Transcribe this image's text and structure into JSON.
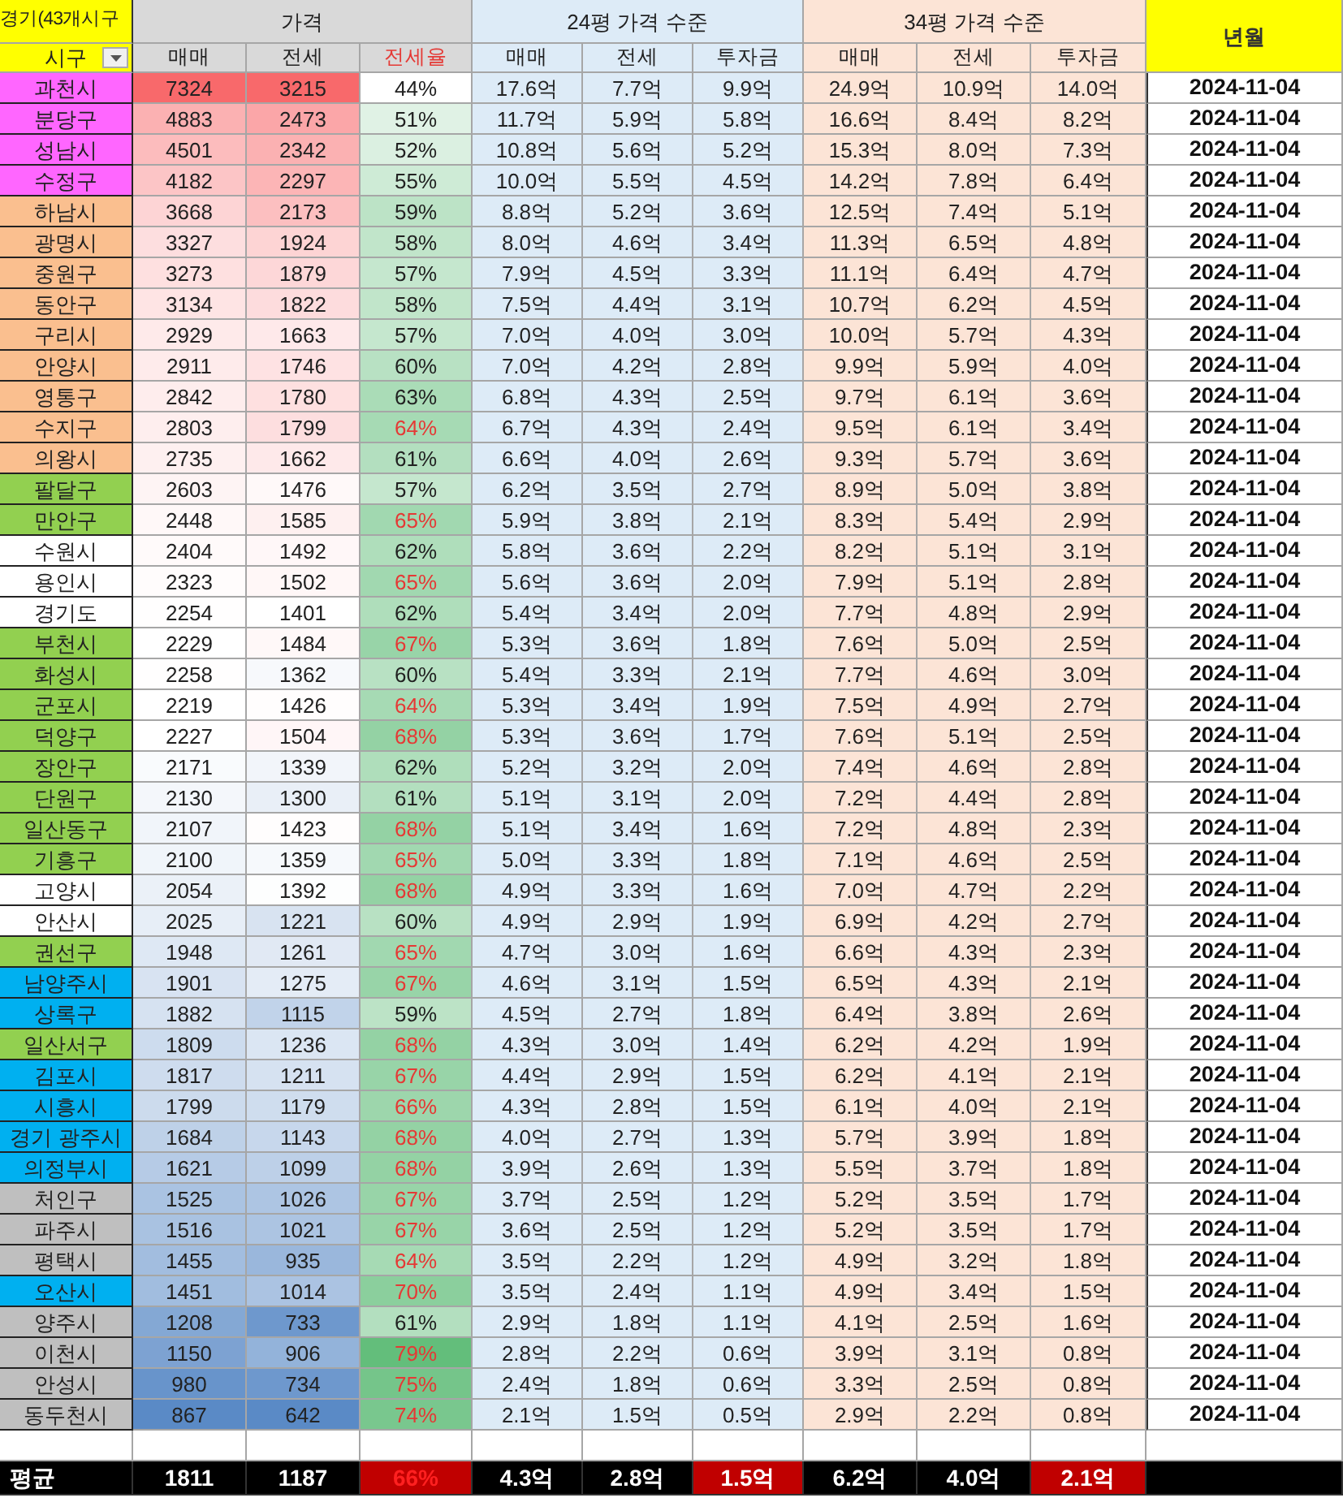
{
  "title_cell": "경기(43개시구",
  "region_header": "시구",
  "price_group": "가격",
  "group24": "24평 가격 수준",
  "group34": "34평 가격 수준",
  "date_header": "년월",
  "price_columns": [
    {
      "label": "매매",
      "highlight": false
    },
    {
      "label": "전세",
      "highlight": false
    },
    {
      "label": "전세율",
      "highlight": true
    }
  ],
  "columns24": [
    "매매",
    "전세",
    "투자금"
  ],
  "columns34": [
    "매매",
    "전세",
    "투자금"
  ],
  "rows": [
    {
      "name": "과천시",
      "color": "#ff66ff",
      "sale": "7324",
      "jeonse": "3215",
      "ratio": "44%",
      "flagged": false,
      "p24": [
        "17.6억",
        "7.7억",
        "9.9억"
      ],
      "p34": [
        "24.9억",
        "10.9억",
        "14.0억"
      ],
      "date": "2024-11-04"
    },
    {
      "name": "분당구",
      "color": "#ff66ff",
      "sale": "4883",
      "jeonse": "2473",
      "ratio": "51%",
      "flagged": false,
      "p24": [
        "11.7억",
        "5.9억",
        "5.8억"
      ],
      "p34": [
        "16.6억",
        "8.4억",
        "8.2억"
      ],
      "date": "2024-11-04"
    },
    {
      "name": "성남시",
      "color": "#ff66ff",
      "sale": "4501",
      "jeonse": "2342",
      "ratio": "52%",
      "flagged": false,
      "p24": [
        "10.8억",
        "5.6억",
        "5.2억"
      ],
      "p34": [
        "15.3억",
        "8.0억",
        "7.3억"
      ],
      "date": "2024-11-04"
    },
    {
      "name": "수정구",
      "color": "#ff66ff",
      "sale": "4182",
      "jeonse": "2297",
      "ratio": "55%",
      "flagged": false,
      "p24": [
        "10.0억",
        "5.5억",
        "4.5억"
      ],
      "p34": [
        "14.2억",
        "7.8억",
        "6.4억"
      ],
      "date": "2024-11-04"
    },
    {
      "name": "하남시",
      "color": "#fabf8f",
      "sale": "3668",
      "jeonse": "2173",
      "ratio": "59%",
      "flagged": false,
      "p24": [
        "8.8억",
        "5.2억",
        "3.6억"
      ],
      "p34": [
        "12.5억",
        "7.4억",
        "5.1억"
      ],
      "date": "2024-11-04"
    },
    {
      "name": "광명시",
      "color": "#fabf8f",
      "sale": "3327",
      "jeonse": "1924",
      "ratio": "58%",
      "flagged": false,
      "p24": [
        "8.0억",
        "4.6억",
        "3.4억"
      ],
      "p34": [
        "11.3억",
        "6.5억",
        "4.8억"
      ],
      "date": "2024-11-04"
    },
    {
      "name": "중원구",
      "color": "#fabf8f",
      "sale": "3273",
      "jeonse": "1879",
      "ratio": "57%",
      "flagged": false,
      "p24": [
        "7.9억",
        "4.5억",
        "3.3억"
      ],
      "p34": [
        "11.1억",
        "6.4억",
        "4.7억"
      ],
      "date": "2024-11-04"
    },
    {
      "name": "동안구",
      "color": "#fabf8f",
      "sale": "3134",
      "jeonse": "1822",
      "ratio": "58%",
      "flagged": false,
      "p24": [
        "7.5억",
        "4.4억",
        "3.1억"
      ],
      "p34": [
        "10.7억",
        "6.2억",
        "4.5억"
      ],
      "date": "2024-11-04"
    },
    {
      "name": "구리시",
      "color": "#fabf8f",
      "sale": "2929",
      "jeonse": "1663",
      "ratio": "57%",
      "flagged": false,
      "p24": [
        "7.0억",
        "4.0억",
        "3.0억"
      ],
      "p34": [
        "10.0억",
        "5.7억",
        "4.3억"
      ],
      "date": "2024-11-04"
    },
    {
      "name": "안양시",
      "color": "#fabf8f",
      "sale": "2911",
      "jeonse": "1746",
      "ratio": "60%",
      "flagged": false,
      "p24": [
        "7.0억",
        "4.2억",
        "2.8억"
      ],
      "p34": [
        "9.9억",
        "5.9억",
        "4.0억"
      ],
      "date": "2024-11-04"
    },
    {
      "name": "영통구",
      "color": "#fabf8f",
      "sale": "2842",
      "jeonse": "1780",
      "ratio": "63%",
      "flagged": false,
      "p24": [
        "6.8억",
        "4.3억",
        "2.5억"
      ],
      "p34": [
        "9.7억",
        "6.1억",
        "3.6억"
      ],
      "date": "2024-11-04"
    },
    {
      "name": "수지구",
      "color": "#fabf8f",
      "sale": "2803",
      "jeonse": "1799",
      "ratio": "64%",
      "flagged": true,
      "p24": [
        "6.7억",
        "4.3억",
        "2.4억"
      ],
      "p34": [
        "9.5억",
        "6.1억",
        "3.4억"
      ],
      "date": "2024-11-04"
    },
    {
      "name": "의왕시",
      "color": "#fabf8f",
      "sale": "2735",
      "jeonse": "1662",
      "ratio": "61%",
      "flagged": false,
      "p24": [
        "6.6억",
        "4.0억",
        "2.6억"
      ],
      "p34": [
        "9.3억",
        "5.7억",
        "3.6억"
      ],
      "date": "2024-11-04"
    },
    {
      "name": "팔달구",
      "color": "#92d050",
      "sale": "2603",
      "jeonse": "1476",
      "ratio": "57%",
      "flagged": false,
      "p24": [
        "6.2억",
        "3.5억",
        "2.7억"
      ],
      "p34": [
        "8.9억",
        "5.0억",
        "3.8억"
      ],
      "date": "2024-11-04"
    },
    {
      "name": "만안구",
      "color": "#92d050",
      "sale": "2448",
      "jeonse": "1585",
      "ratio": "65%",
      "flagged": true,
      "p24": [
        "5.9억",
        "3.8억",
        "2.1억"
      ],
      "p34": [
        "8.3억",
        "5.4억",
        "2.9억"
      ],
      "date": "2024-11-04"
    },
    {
      "name": "수원시",
      "color": "#ffffff",
      "sale": "2404",
      "jeonse": "1492",
      "ratio": "62%",
      "flagged": false,
      "p24": [
        "5.8억",
        "3.6억",
        "2.2억"
      ],
      "p34": [
        "8.2억",
        "5.1억",
        "3.1억"
      ],
      "date": "2024-11-04"
    },
    {
      "name": "용인시",
      "color": "#ffffff",
      "sale": "2323",
      "jeonse": "1502",
      "ratio": "65%",
      "flagged": true,
      "p24": [
        "5.6억",
        "3.6억",
        "2.0억"
      ],
      "p34": [
        "7.9억",
        "5.1억",
        "2.8억"
      ],
      "date": "2024-11-04"
    },
    {
      "name": "경기도",
      "color": "#ffffff",
      "sale": "2254",
      "jeonse": "1401",
      "ratio": "62%",
      "flagged": false,
      "p24": [
        "5.4억",
        "3.4억",
        "2.0억"
      ],
      "p34": [
        "7.7억",
        "4.8억",
        "2.9억"
      ],
      "date": "2024-11-04"
    },
    {
      "name": "부천시",
      "color": "#92d050",
      "sale": "2229",
      "jeonse": "1484",
      "ratio": "67%",
      "flagged": true,
      "p24": [
        "5.3억",
        "3.6억",
        "1.8억"
      ],
      "p34": [
        "7.6억",
        "5.0억",
        "2.5억"
      ],
      "date": "2024-11-04"
    },
    {
      "name": "화성시",
      "color": "#92d050",
      "sale": "2258",
      "jeonse": "1362",
      "ratio": "60%",
      "flagged": false,
      "p24": [
        "5.4억",
        "3.3억",
        "2.1억"
      ],
      "p34": [
        "7.7억",
        "4.6억",
        "3.0억"
      ],
      "date": "2024-11-04"
    },
    {
      "name": "군포시",
      "color": "#92d050",
      "sale": "2219",
      "jeonse": "1426",
      "ratio": "64%",
      "flagged": true,
      "p24": [
        "5.3억",
        "3.4억",
        "1.9억"
      ],
      "p34": [
        "7.5억",
        "4.9억",
        "2.7억"
      ],
      "date": "2024-11-04"
    },
    {
      "name": "덕양구",
      "color": "#92d050",
      "sale": "2227",
      "jeonse": "1504",
      "ratio": "68%",
      "flagged": true,
      "p24": [
        "5.3억",
        "3.6억",
        "1.7억"
      ],
      "p34": [
        "7.6억",
        "5.1억",
        "2.5억"
      ],
      "date": "2024-11-04"
    },
    {
      "name": "장안구",
      "color": "#92d050",
      "sale": "2171",
      "jeonse": "1339",
      "ratio": "62%",
      "flagged": false,
      "p24": [
        "5.2억",
        "3.2억",
        "2.0억"
      ],
      "p34": [
        "7.4억",
        "4.6억",
        "2.8억"
      ],
      "date": "2024-11-04"
    },
    {
      "name": "단원구",
      "color": "#92d050",
      "sale": "2130",
      "jeonse": "1300",
      "ratio": "61%",
      "flagged": false,
      "p24": [
        "5.1억",
        "3.1억",
        "2.0억"
      ],
      "p34": [
        "7.2억",
        "4.4억",
        "2.8억"
      ],
      "date": "2024-11-04"
    },
    {
      "name": "일산동구",
      "color": "#92d050",
      "sale": "2107",
      "jeonse": "1423",
      "ratio": "68%",
      "flagged": true,
      "p24": [
        "5.1억",
        "3.4억",
        "1.6억"
      ],
      "p34": [
        "7.2억",
        "4.8억",
        "2.3억"
      ],
      "date": "2024-11-04"
    },
    {
      "name": "기흥구",
      "color": "#92d050",
      "sale": "2100",
      "jeonse": "1359",
      "ratio": "65%",
      "flagged": true,
      "p24": [
        "5.0억",
        "3.3억",
        "1.8억"
      ],
      "p34": [
        "7.1억",
        "4.6억",
        "2.5억"
      ],
      "date": "2024-11-04"
    },
    {
      "name": "고양시",
      "color": "#ffffff",
      "sale": "2054",
      "jeonse": "1392",
      "ratio": "68%",
      "flagged": true,
      "p24": [
        "4.9억",
        "3.3억",
        "1.6억"
      ],
      "p34": [
        "7.0억",
        "4.7억",
        "2.2억"
      ],
      "date": "2024-11-04"
    },
    {
      "name": "안산시",
      "color": "#ffffff",
      "sale": "2025",
      "jeonse": "1221",
      "ratio": "60%",
      "flagged": false,
      "p24": [
        "4.9억",
        "2.9억",
        "1.9억"
      ],
      "p34": [
        "6.9억",
        "4.2억",
        "2.7억"
      ],
      "date": "2024-11-04"
    },
    {
      "name": "권선구",
      "color": "#92d050",
      "sale": "1948",
      "jeonse": "1261",
      "ratio": "65%",
      "flagged": true,
      "p24": [
        "4.7억",
        "3.0억",
        "1.6억"
      ],
      "p34": [
        "6.6억",
        "4.3억",
        "2.3억"
      ],
      "date": "2024-11-04"
    },
    {
      "name": "남양주시",
      "color": "#00b0f0",
      "sale": "1901",
      "jeonse": "1275",
      "ratio": "67%",
      "flagged": true,
      "p24": [
        "4.6억",
        "3.1억",
        "1.5억"
      ],
      "p34": [
        "6.5억",
        "4.3억",
        "2.1억"
      ],
      "date": "2024-11-04"
    },
    {
      "name": "상록구",
      "color": "#00b0f0",
      "sale": "1882",
      "jeonse": "1115",
      "ratio": "59%",
      "flagged": false,
      "p24": [
        "4.5억",
        "2.7억",
        "1.8억"
      ],
      "p34": [
        "6.4억",
        "3.8억",
        "2.6억"
      ],
      "date": "2024-11-04"
    },
    {
      "name": "일산서구",
      "color": "#92d050",
      "sale": "1809",
      "jeonse": "1236",
      "ratio": "68%",
      "flagged": true,
      "p24": [
        "4.3억",
        "3.0억",
        "1.4억"
      ],
      "p34": [
        "6.2억",
        "4.2억",
        "1.9억"
      ],
      "date": "2024-11-04"
    },
    {
      "name": "김포시",
      "color": "#00b0f0",
      "sale": "1817",
      "jeonse": "1211",
      "ratio": "67%",
      "flagged": true,
      "p24": [
        "4.4억",
        "2.9억",
        "1.5억"
      ],
      "p34": [
        "6.2억",
        "4.1억",
        "2.1억"
      ],
      "date": "2024-11-04"
    },
    {
      "name": "시흥시",
      "color": "#00b0f0",
      "sale": "1799",
      "jeonse": "1179",
      "ratio": "66%",
      "flagged": true,
      "p24": [
        "4.3억",
        "2.8억",
        "1.5억"
      ],
      "p34": [
        "6.1억",
        "4.0억",
        "2.1억"
      ],
      "date": "2024-11-04"
    },
    {
      "name": "경기 광주시",
      "color": "#00b0f0",
      "sale": "1684",
      "jeonse": "1143",
      "ratio": "68%",
      "flagged": true,
      "p24": [
        "4.0억",
        "2.7억",
        "1.3억"
      ],
      "p34": [
        "5.7억",
        "3.9억",
        "1.8억"
      ],
      "date": "2024-11-04"
    },
    {
      "name": "의정부시",
      "color": "#00b0f0",
      "sale": "1621",
      "jeonse": "1099",
      "ratio": "68%",
      "flagged": true,
      "p24": [
        "3.9억",
        "2.6억",
        "1.3억"
      ],
      "p34": [
        "5.5억",
        "3.7억",
        "1.8억"
      ],
      "date": "2024-11-04"
    },
    {
      "name": "처인구",
      "color": "#bfbfbf",
      "sale": "1525",
      "jeonse": "1026",
      "ratio": "67%",
      "flagged": true,
      "p24": [
        "3.7억",
        "2.5억",
        "1.2억"
      ],
      "p34": [
        "5.2억",
        "3.5억",
        "1.7억"
      ],
      "date": "2024-11-04"
    },
    {
      "name": "파주시",
      "color": "#bfbfbf",
      "sale": "1516",
      "jeonse": "1021",
      "ratio": "67%",
      "flagged": true,
      "p24": [
        "3.6억",
        "2.5억",
        "1.2억"
      ],
      "p34": [
        "5.2억",
        "3.5억",
        "1.7억"
      ],
      "date": "2024-11-04"
    },
    {
      "name": "평택시",
      "color": "#bfbfbf",
      "sale": "1455",
      "jeonse": "935",
      "ratio": "64%",
      "flagged": true,
      "p24": [
        "3.5억",
        "2.2억",
        "1.2억"
      ],
      "p34": [
        "4.9억",
        "3.2억",
        "1.8억"
      ],
      "date": "2024-11-04"
    },
    {
      "name": "오산시",
      "color": "#00b0f0",
      "sale": "1451",
      "jeonse": "1014",
      "ratio": "70%",
      "flagged": true,
      "p24": [
        "3.5억",
        "2.4억",
        "1.1억"
      ],
      "p34": [
        "4.9억",
        "3.4억",
        "1.5억"
      ],
      "date": "2024-11-04"
    },
    {
      "name": "양주시",
      "color": "#bfbfbf",
      "sale": "1208",
      "jeonse": "733",
      "ratio": "61%",
      "flagged": false,
      "p24": [
        "2.9억",
        "1.8억",
        "1.1억"
      ],
      "p34": [
        "4.1억",
        "2.5억",
        "1.6억"
      ],
      "date": "2024-11-04"
    },
    {
      "name": "이천시",
      "color": "#bfbfbf",
      "sale": "1150",
      "jeonse": "906",
      "ratio": "79%",
      "flagged": true,
      "p24": [
        "2.8억",
        "2.2억",
        "0.6억"
      ],
      "p34": [
        "3.9억",
        "3.1억",
        "0.8억"
      ],
      "date": "2024-11-04"
    },
    {
      "name": "안성시",
      "color": "#bfbfbf",
      "sale": "980",
      "jeonse": "734",
      "ratio": "75%",
      "flagged": true,
      "p24": [
        "2.4억",
        "1.8억",
        "0.6억"
      ],
      "p34": [
        "3.3억",
        "2.5억",
        "0.8억"
      ],
      "date": "2024-11-04"
    },
    {
      "name": "동두천시",
      "color": "#bfbfbf",
      "sale": "867",
      "jeonse": "642",
      "ratio": "74%",
      "flagged": true,
      "p24": [
        "2.1억",
        "1.5억",
        "0.5억"
      ],
      "p34": [
        "2.9억",
        "2.2억",
        "0.8억"
      ],
      "date": "2024-11-04"
    }
  ],
  "average": {
    "label": "평균",
    "cells": [
      {
        "text": "1811",
        "flagged": false,
        "red_text": false
      },
      {
        "text": "1187",
        "flagged": false,
        "red_text": false
      },
      {
        "text": "66%",
        "flagged": true,
        "red_text": true
      },
      {
        "text": "4.3억",
        "flagged": false,
        "red_text": false
      },
      {
        "text": "2.8억",
        "flagged": false,
        "red_text": false
      },
      {
        "text": "1.5억",
        "flagged": true,
        "red_text": false
      },
      {
        "text": "6.2억",
        "flagged": false,
        "red_text": false
      },
      {
        "text": "4.0억",
        "flagged": false,
        "red_text": false
      },
      {
        "text": "2.1억",
        "flagged": true,
        "red_text": false
      }
    ]
  }
}
